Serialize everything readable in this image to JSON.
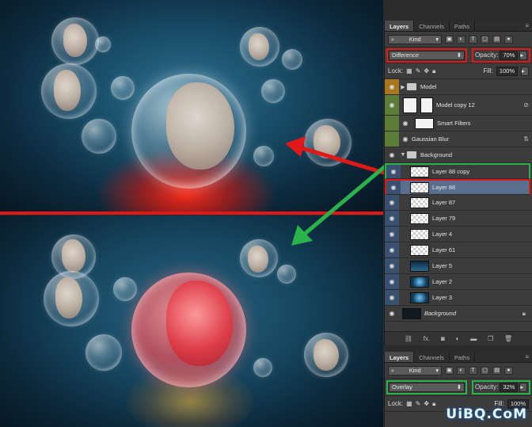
{
  "panel_top": {
    "tabs": [
      "Layers",
      "Channels",
      "Paths"
    ],
    "filter_kind": "Kind",
    "blend_mode": "Difference",
    "opacity_label": "Opacity:",
    "opacity_value": "70%",
    "lock_label": "Lock:",
    "fill_label": "Fill:",
    "fill_value": "100%",
    "layers": [
      {
        "name": "Model",
        "type": "group"
      },
      {
        "name": "Model copy 12",
        "type": "smart"
      },
      {
        "name": "Smart Filters",
        "type": "filter"
      },
      {
        "name": "Gaussian Blur",
        "type": "filter-item"
      },
      {
        "name": "Background",
        "type": "group"
      },
      {
        "name": "Layer 88 copy",
        "type": "layer"
      },
      {
        "name": "Layer 88",
        "type": "layer",
        "selected": true
      },
      {
        "name": "Layer 87",
        "type": "layer"
      },
      {
        "name": "Layer 79",
        "type": "layer"
      },
      {
        "name": "Layer 4",
        "type": "layer"
      },
      {
        "name": "Layer 61",
        "type": "layer"
      },
      {
        "name": "Layer 5",
        "type": "layer"
      },
      {
        "name": "Layer 2",
        "type": "layer"
      },
      {
        "name": "Layer 3",
        "type": "layer"
      },
      {
        "name": "Background",
        "type": "background"
      }
    ],
    "footer_icons": [
      "link-icon",
      "fx-icon",
      "mask-icon",
      "adjustment-icon",
      "folder-icon",
      "new-layer-icon",
      "trash-icon"
    ],
    "footer_fx": "fx."
  },
  "panel_bottom": {
    "tabs": [
      "Layers",
      "Channels",
      "Paths"
    ],
    "filter_kind": "Kind",
    "blend_mode": "Overlay",
    "opacity_label": "Opacity:",
    "opacity_value": "32%",
    "lock_label": "Lock:",
    "fill_label": "Fill:",
    "fill_value": "100%"
  },
  "watermark": "UiBQ.CoM",
  "colors": {
    "highlight_red": "#e01818",
    "highlight_green": "#29b34a",
    "selected_layer": "#596f8d"
  }
}
